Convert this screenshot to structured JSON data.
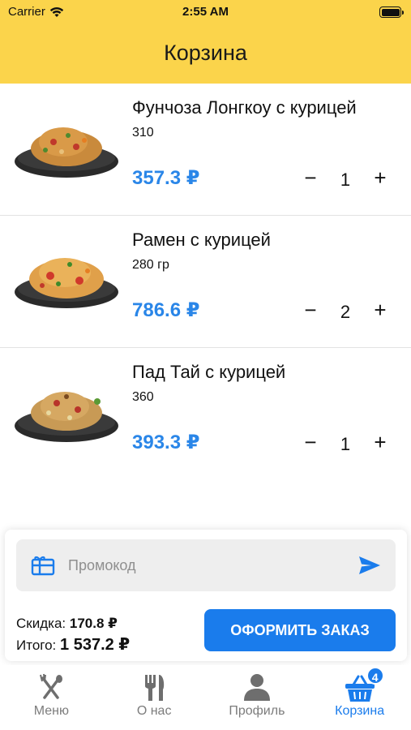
{
  "status_bar": {
    "carrier": "Carrier",
    "time": "2:55 AM"
  },
  "header": {
    "title": "Корзина"
  },
  "cart": {
    "items": [
      {
        "name": "Фунчоза Лонгкоу с курицей",
        "weight": "310",
        "price": "357.3 ₽",
        "quantity": "1"
      },
      {
        "name": "Рамен с курицей",
        "weight": "280 гр",
        "price": "786.6 ₽",
        "quantity": "2"
      },
      {
        "name": "Пад Тай с курицей",
        "weight": "360",
        "price": "393.3 ₽",
        "quantity": "1"
      }
    ],
    "minus_symbol": "−",
    "plus_symbol": "+"
  },
  "promo": {
    "placeholder": "Промокод",
    "icon": "gift-card-icon",
    "send_icon": "send-icon"
  },
  "summary": {
    "discount_label": "Скидка:",
    "discount_value": "170.8 ₽",
    "total_label": "Итого:",
    "total_value": "1 537.2 ₽",
    "order_button": "ОФОРМИТЬ ЗАКАЗ"
  },
  "tabbar": {
    "tabs": [
      {
        "label": "Меню",
        "icon": "fork-spoon-icon"
      },
      {
        "label": "О нас",
        "icon": "fork-knife-icon"
      },
      {
        "label": "Профиль",
        "icon": "person-icon"
      },
      {
        "label": "Корзина",
        "icon": "basket-icon",
        "badge": "4",
        "active": true
      }
    ]
  },
  "colors": {
    "header_bg": "#fbd44b",
    "accent": "#1a7cec",
    "price": "#2a86e8"
  }
}
